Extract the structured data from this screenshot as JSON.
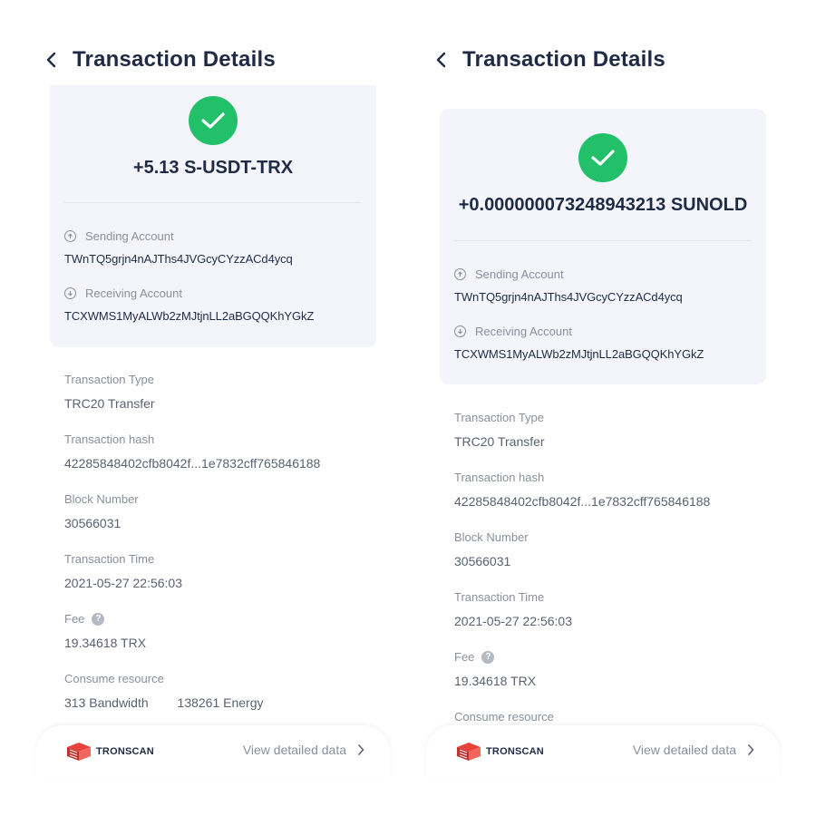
{
  "panels": [
    {
      "title": "Transaction Details",
      "amount": "+5.13 S-USDT-TRX",
      "sending": {
        "label": "Sending Account",
        "value": "TWnTQ5grjn4nAJThs4JVGcyCYzzACd4ycq"
      },
      "receiving": {
        "label": "Receiving Account",
        "value": "TCXWMS1MyALWb2zMJtjnLL2aBGQQKhYGkZ"
      },
      "fields": {
        "type": {
          "label": "Transaction Type",
          "value": "TRC20 Transfer"
        },
        "hash": {
          "label": "Transaction hash",
          "value": "42285848402cfb8042f...1e7832cff765846188"
        },
        "block": {
          "label": "Block Number",
          "value": "30566031"
        },
        "time": {
          "label": "Transaction Time",
          "value": "2021-05-27 22:56:03"
        },
        "fee": {
          "label": "Fee",
          "value": "19.34618  TRX"
        },
        "resource": {
          "label": "Consume resource",
          "bandwidth": "313  Bandwidth",
          "energy": "138261  Energy"
        }
      },
      "footer": {
        "brand": "TRONSCAN",
        "link": "View detailed data"
      }
    },
    {
      "title": "Transaction Details",
      "amount": "+0.000000073248943213 SUNOLD",
      "sending": {
        "label": "Sending Account",
        "value": "TWnTQ5grjn4nAJThs4JVGcyCYzzACd4ycq"
      },
      "receiving": {
        "label": "Receiving Account",
        "value": "TCXWMS1MyALWb2zMJtjnLL2aBGQQKhYGkZ"
      },
      "fields": {
        "type": {
          "label": "Transaction Type",
          "value": "TRC20 Transfer"
        },
        "hash": {
          "label": "Transaction hash",
          "value": "42285848402cfb8042f...1e7832cff765846188"
        },
        "block": {
          "label": "Block Number",
          "value": "30566031"
        },
        "time": {
          "label": "Transaction Time",
          "value": "2021-05-27 22:56:03"
        },
        "fee": {
          "label": "Fee",
          "value": "19.34618  TRX"
        },
        "resource": {
          "label": "Consume resource"
        }
      },
      "footer": {
        "brand": "TRONSCAN",
        "link": "View detailed data"
      }
    }
  ],
  "colors": {
    "success": "#23c06a",
    "card_bg": "#f3f5fb",
    "title": "#1f2a44",
    "muted": "#8a8f9c"
  },
  "icons": [
    "chevron-left-icon",
    "check-icon",
    "arrow-up-circle-icon",
    "arrow-down-circle-icon",
    "help-icon",
    "tronscan-logo",
    "chevron-right-icon"
  ]
}
